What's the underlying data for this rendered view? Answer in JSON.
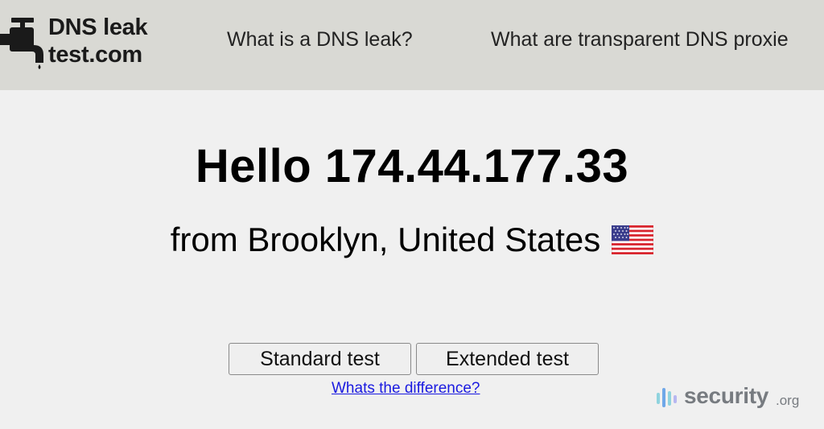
{
  "header": {
    "logo": {
      "line1": "DNS leak",
      "line2": "test.com"
    },
    "nav": [
      {
        "label": "What is a DNS leak?"
      },
      {
        "label": "What are transparent DNS proxie"
      }
    ]
  },
  "main": {
    "greeting": "Hello 174.44.177.33",
    "location": "from Brooklyn, United States",
    "flag_icon": "us-flag-icon",
    "buttons": {
      "standard": "Standard test",
      "extended": "Extended test"
    },
    "difference_link": "Whats the difference?"
  },
  "watermark": {
    "main": "security",
    "suffix": ".org"
  },
  "colors": {
    "header_bg": "#d9d9d4",
    "page_bg": "#f0f0f0",
    "link": "#1a1ae0",
    "watermark": "#777b80",
    "watermark_accent": "#7fd6e0"
  }
}
